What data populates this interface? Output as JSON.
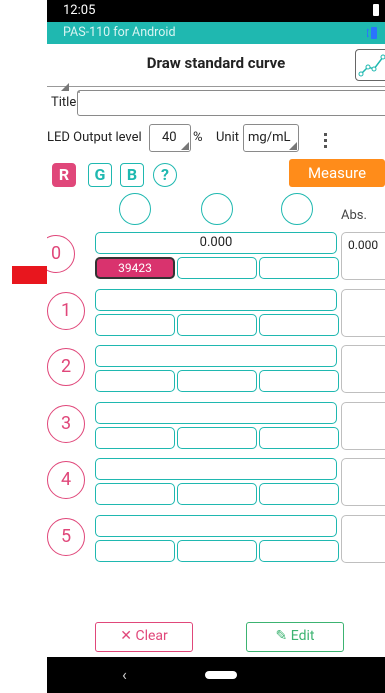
{
  "status_bar": {
    "time": "12:05"
  },
  "app": {
    "name": "PAS-110 for Android"
  },
  "header": {
    "title": "Draw standard curve"
  },
  "form": {
    "title_label": "Title",
    "title_value": "",
    "led_label": "LED Output level",
    "led_value": "40",
    "led_unit": "%",
    "unit_label": "Unit",
    "unit_value": "mg/mL"
  },
  "channels": [
    {
      "label": "R",
      "active": true
    },
    {
      "label": "G",
      "active": false
    },
    {
      "label": "B",
      "active": false
    },
    {
      "label": "?",
      "active": false
    }
  ],
  "measure_label": "Measure",
  "abs_header": "Abs.",
  "rows": [
    {
      "index": "0",
      "concentration": "0.000",
      "values": [
        "39423",
        "",
        ""
      ],
      "abs": "0.000"
    },
    {
      "index": "1",
      "concentration": "",
      "values": [
        "",
        "",
        ""
      ],
      "abs": ""
    },
    {
      "index": "2",
      "concentration": "",
      "values": [
        "",
        "",
        ""
      ],
      "abs": ""
    },
    {
      "index": "3",
      "concentration": "",
      "values": [
        "",
        "",
        ""
      ],
      "abs": ""
    },
    {
      "index": "4",
      "concentration": "",
      "values": [
        "",
        "",
        ""
      ],
      "abs": ""
    },
    {
      "index": "5",
      "concentration": "",
      "values": [
        "",
        "",
        ""
      ],
      "abs": ""
    }
  ],
  "footer": {
    "clear_label": "Clear",
    "edit_label": "Edit"
  },
  "colors": {
    "teal": "#1fb8b0",
    "pink": "#e0477a",
    "orange": "#ff8c1a",
    "active_cell": "#d9336e",
    "arrow": "#e8161e"
  }
}
